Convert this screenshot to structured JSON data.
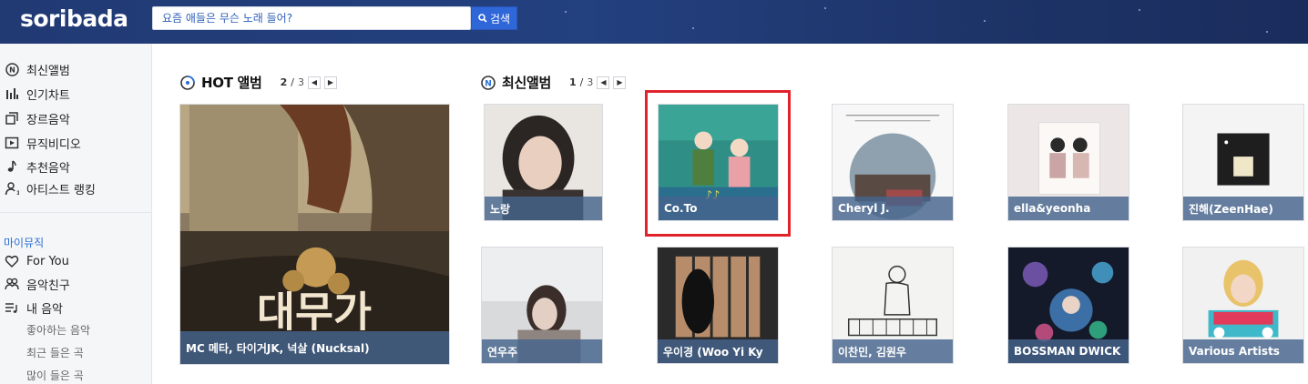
{
  "header": {
    "logo": "soribada",
    "search_placeholder": "요즘 애들은 무슨 노래 들어?",
    "search_button": "검색"
  },
  "sidebar": {
    "items": [
      {
        "label": "최신앨범",
        "icon": "new-album-icon"
      },
      {
        "label": "인기차트",
        "icon": "chart-bars-icon"
      },
      {
        "label": "장르음악",
        "icon": "genre-stack-icon"
      },
      {
        "label": "뮤직비디오",
        "icon": "play-video-icon"
      },
      {
        "label": "추천음악",
        "icon": "music-note-icon"
      },
      {
        "label": "아티스트 랭킹",
        "icon": "artist-rank-icon"
      }
    ],
    "my_music": {
      "title": "마이뮤직",
      "items": [
        {
          "label": "For You",
          "icon": "heart-icon"
        },
        {
          "label": "음악친구",
          "icon": "friends-icon"
        },
        {
          "label": "내 음악",
          "icon": "playlist-icon"
        }
      ],
      "sub_items": [
        "좋아하는 음악",
        "최근 들은 곡",
        "많이 들은 곡"
      ]
    }
  },
  "hot_album": {
    "title": "HOT 앨범",
    "page_current": "2",
    "page_total": "3",
    "album": {
      "artist": "MC 메타, 타이거JK, 넉살 (Nucksal)",
      "cover_text": "대무가"
    }
  },
  "new_albums": {
    "title": "최신앨범",
    "page_current": "1",
    "page_total": "3",
    "albums": [
      {
        "artist": "노랑"
      },
      {
        "artist": "Co.To"
      },
      {
        "artist": "Cheryl J."
      },
      {
        "artist": "ella&yeonha"
      },
      {
        "artist": "진해(ZeenHae)"
      },
      {
        "artist": "연우주"
      },
      {
        "artist": "우이경 (Woo Yi Ky"
      },
      {
        "artist": "이찬민, 김원우"
      },
      {
        "artist": "BOSSMAN DWICK"
      },
      {
        "artist": "Various Artists"
      }
    ]
  },
  "colors": {
    "header_bg": "#213a74",
    "accent_blue": "#2f66d8",
    "highlight_red": "#e0232b",
    "caption_bg": "#46648c"
  }
}
